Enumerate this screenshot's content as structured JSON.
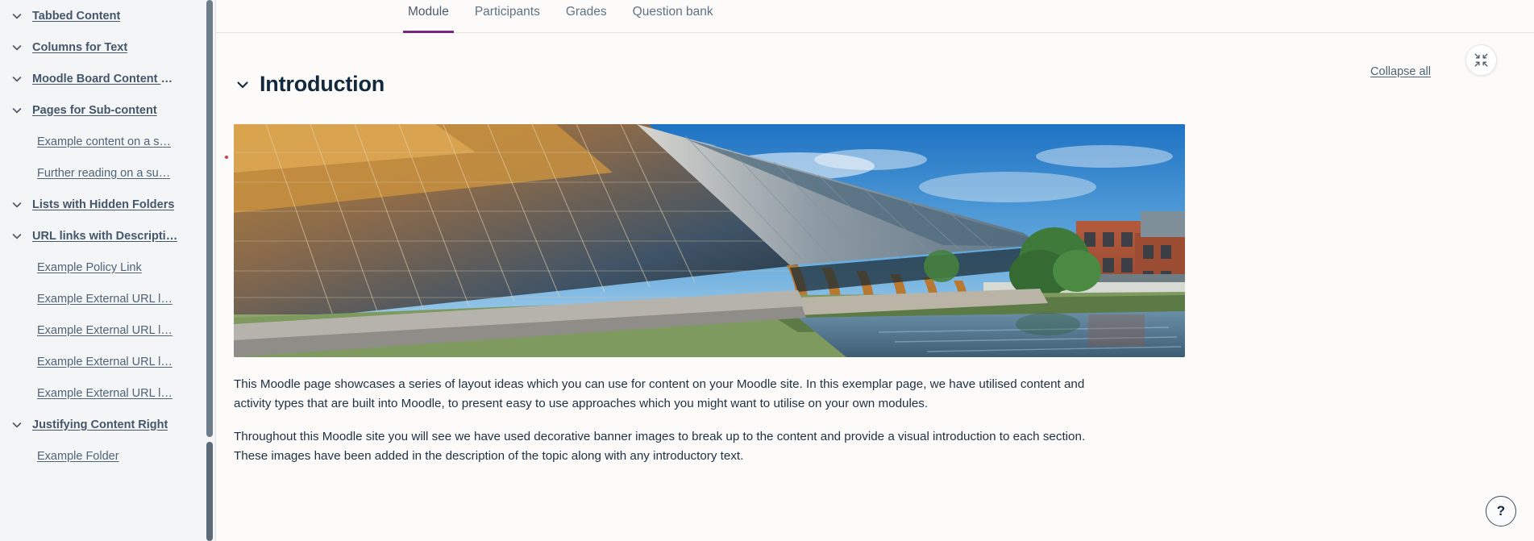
{
  "sidebar": {
    "items": [
      {
        "label": "Tabbed Content",
        "level": "top",
        "icon": "chevron-down-icon"
      },
      {
        "label": "Columns for Text",
        "level": "top",
        "icon": "chevron-down-icon"
      },
      {
        "label": "Moodle Board Content w…",
        "level": "top",
        "icon": "chevron-down-icon"
      },
      {
        "label": "Pages for Sub-content",
        "level": "top",
        "icon": "chevron-down-icon"
      },
      {
        "label": "Example content on a s…",
        "level": "sub",
        "icon": ""
      },
      {
        "label": "Further reading on a su…",
        "level": "sub",
        "icon": ""
      },
      {
        "label": "Lists with Hidden Folders",
        "level": "top",
        "icon": "chevron-down-icon"
      },
      {
        "label": "URL links with Descripti…",
        "level": "top",
        "icon": "chevron-down-icon"
      },
      {
        "label": "Example Policy Link",
        "level": "sub",
        "icon": ""
      },
      {
        "label": "Example External URL l…",
        "level": "sub",
        "icon": ""
      },
      {
        "label": "Example External URL l…",
        "level": "sub",
        "icon": ""
      },
      {
        "label": "Example External URL l…",
        "level": "sub",
        "icon": ""
      },
      {
        "label": "Example External URL l…",
        "level": "sub",
        "icon": ""
      },
      {
        "label": "Justifying Content Right",
        "level": "top",
        "icon": "chevron-down-icon"
      },
      {
        "label": "Example Folder",
        "level": "sub",
        "icon": ""
      }
    ]
  },
  "tabs": [
    {
      "label": "Module",
      "active": true
    },
    {
      "label": "Participants",
      "active": false
    },
    {
      "label": "Grades",
      "active": false
    },
    {
      "label": "Question bank",
      "active": false
    }
  ],
  "section": {
    "title": "Introduction",
    "collapse_all_label": "Collapse all",
    "collapse_icon": "collapse-arrows-icon",
    "toggle_icon": "chevron-down-icon",
    "banner_alt": "Campus building with glass facade and timber arches beside a canal"
  },
  "paragraphs": [
    "This Moodle page showcases a series of layout ideas which you can use for content on your Moodle site. In this exemplar page, we have utilised content and activity types that are built into Moodle, to present easy to use approaches which you might want to utilise on your own modules.",
    "Throughout this Moodle site you will see we have used decorative banner images to break up to the content and provide a visual introduction to each section. These images have been added in the description of the topic along with any introductory text."
  ],
  "help": {
    "label": "?",
    "icon": "question-mark-icon"
  },
  "colors": {
    "accent": "#76277f",
    "sidebar_bg": "#f4f5f7",
    "page_bg": "#fcfbfa",
    "link": "#4d6274",
    "heading": "#12283c"
  }
}
